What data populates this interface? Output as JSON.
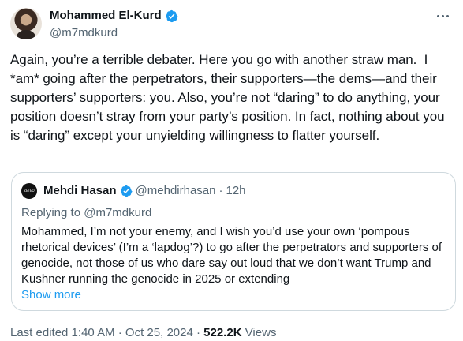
{
  "author": {
    "display_name": "Mohammed El-Kurd",
    "handle": "@m7mdkurd",
    "verified": true
  },
  "tweet": {
    "text": "Again, you’re a terrible debater. Here you go with another straw man.  I *am* going after the perpetrators, their supporters—the dems—and their supporters’ supporters: you. Also, you’re not “daring” to do anything, your position doesn’t stray from your party’s position. In fact, nothing about you is “daring” except your unyielding willingness to flatter yourself."
  },
  "quote": {
    "avatar_text": "ZETEO",
    "display_name": "Mehdi Hasan",
    "handle": "@mehdirhasan",
    "separator": "·",
    "time": "12h",
    "replying_prefix": "Replying to ",
    "replying_handle": "@m7mdkurd",
    "text": "Mohammed, I’m not your enemy, and I wish you’d use your own ‘pompous rhetorical devices’ (I’m a ‘lapdog’?) to go after the perpetrators and supporters of genocide, not those of us who dare say out loud that we don’t want Trump and Kushner running the genocide in 2025 or extending",
    "show_more": "Show more"
  },
  "meta": {
    "edited": "Last edited 1:40 AM · Oct 25, 2024 · ",
    "views_count": "522.2K",
    "views_label": " Views"
  },
  "colors": {
    "verified": "#1d9bf0",
    "link": "#1d9bf0",
    "secondary_text": "#536471",
    "border": "#cfd9de"
  },
  "icons": {
    "verified": "verified-badge-icon",
    "more": "more-dots-icon"
  }
}
